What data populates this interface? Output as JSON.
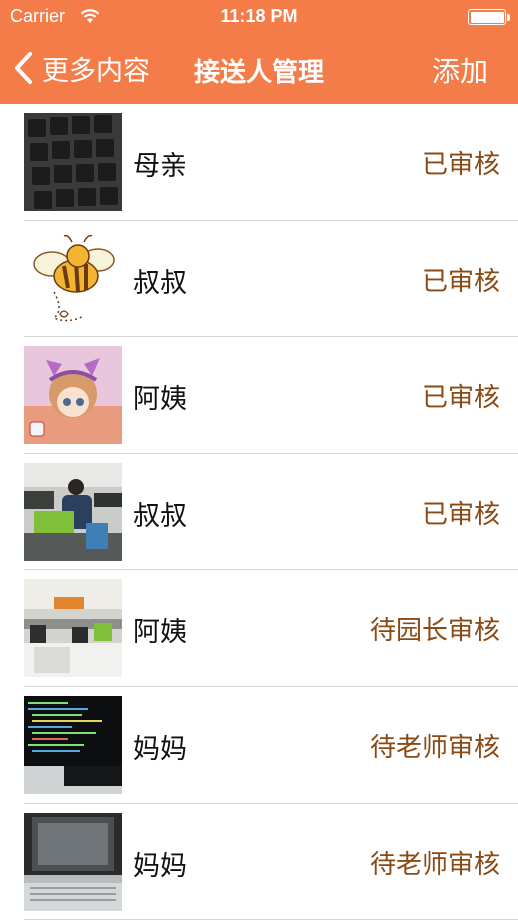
{
  "status_bar": {
    "carrier": "Carrier",
    "time": "11:18 PM"
  },
  "nav": {
    "back_label": "更多内容",
    "title": "接送人管理",
    "add_label": "添加"
  },
  "colors": {
    "nav_background": "#f47c48",
    "status_text": "#8a4a16",
    "separator": "#d6d6d6"
  },
  "contacts": [
    {
      "name": "母亲",
      "status": "已审核",
      "avatar": "keyboard-photo"
    },
    {
      "name": "叔叔",
      "status": "已审核",
      "avatar": "bee-cartoon"
    },
    {
      "name": "阿姨",
      "status": "已审核",
      "avatar": "anime-girl"
    },
    {
      "name": "叔叔",
      "status": "已审核",
      "avatar": "office-photo"
    },
    {
      "name": "阿姨",
      "status": "待园长审核",
      "avatar": "office-photo"
    },
    {
      "name": "妈妈",
      "status": "待老师审核",
      "avatar": "terminal-screen-photo"
    },
    {
      "name": "妈妈",
      "status": "待老师审核",
      "avatar": "laptop-screen-photo"
    }
  ]
}
